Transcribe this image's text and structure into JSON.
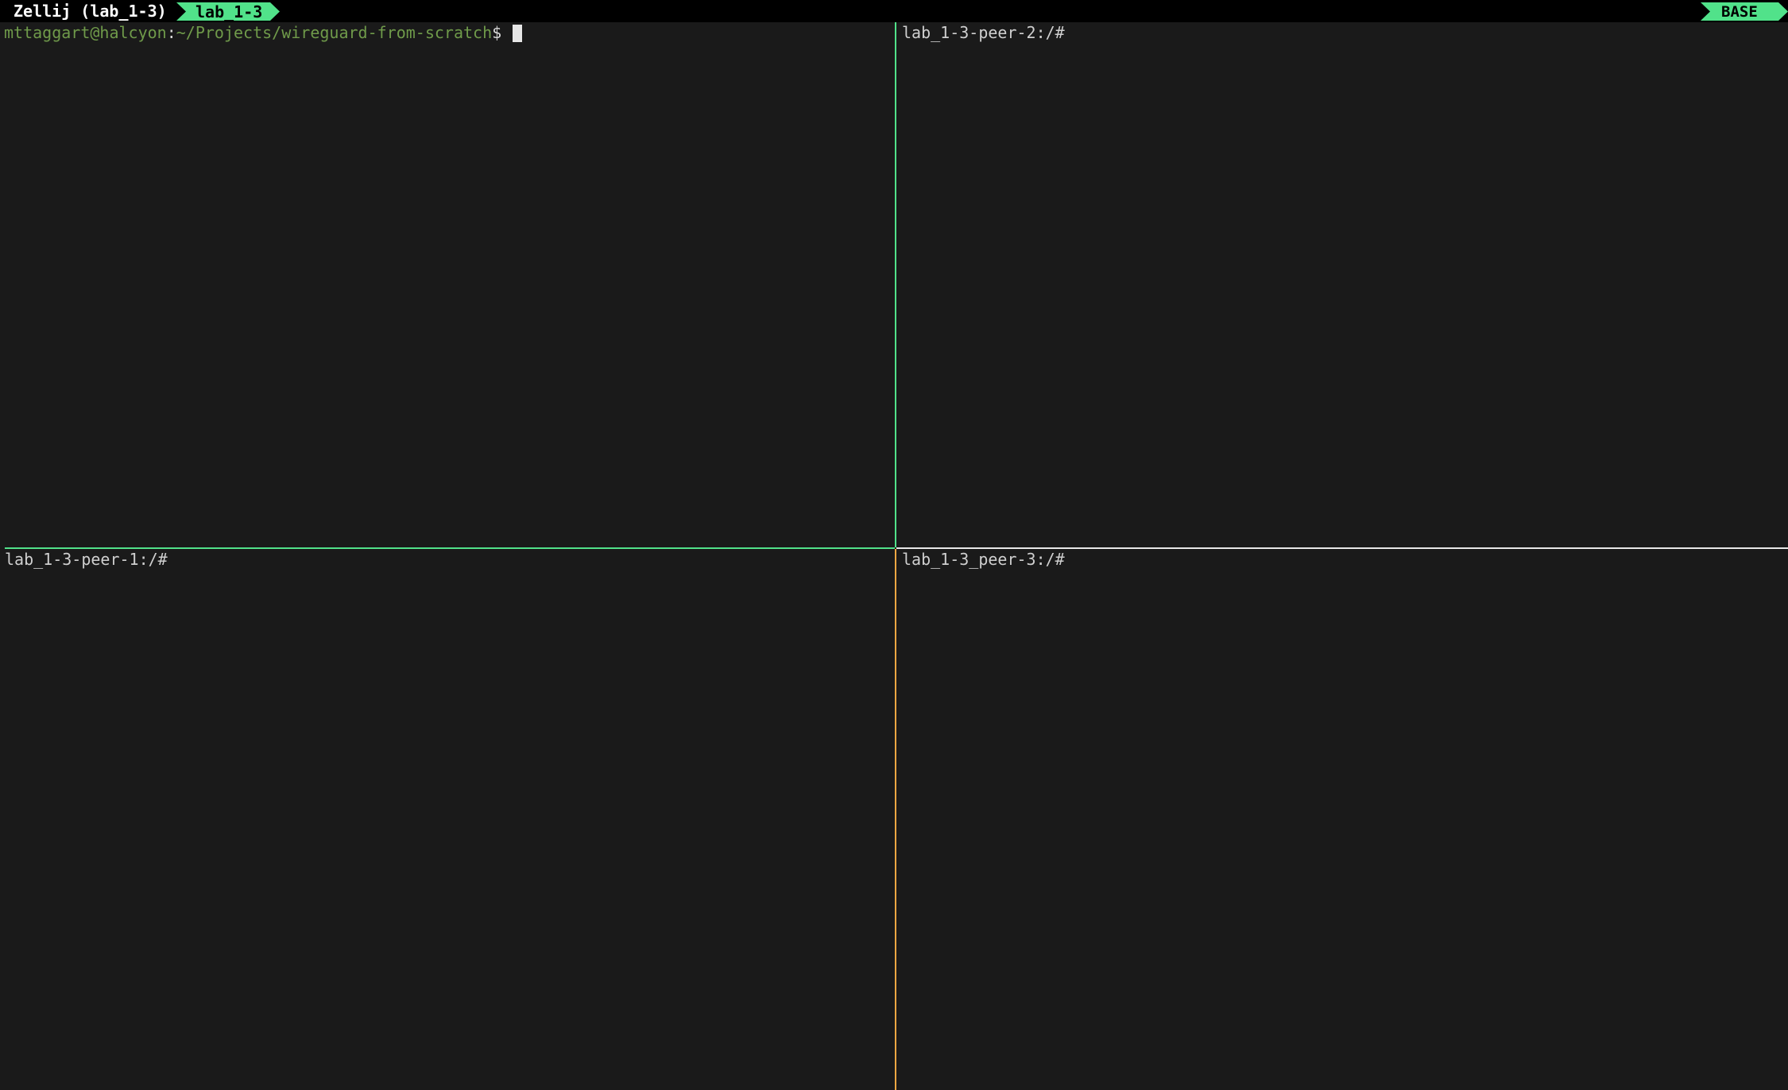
{
  "tab_bar": {
    "session_label": "Zellij (lab_1-3)",
    "active_tab_label": "lab_1-3",
    "mode_label": "BASE",
    "active_tab_color": "#51e28a"
  },
  "panes": {
    "top_left": {
      "user_host": "mttaggart@halcyon",
      "separator": ":",
      "cwd": "~/Projects/wireguard-from-scratch",
      "prompt_char": "$ "
    },
    "top_right": {
      "prompt": "lab_1-3-peer-2:/#"
    },
    "bottom_left": {
      "prompt": "lab_1-3-peer-1:/#"
    },
    "bottom_right": {
      "prompt": "lab_1-3_peer-3:/#"
    }
  },
  "colors": {
    "background": "#1a1a1a",
    "focused_border": "#51e28a",
    "orange_border": "#f0a742",
    "prompt_green": "#6f9a4a"
  }
}
